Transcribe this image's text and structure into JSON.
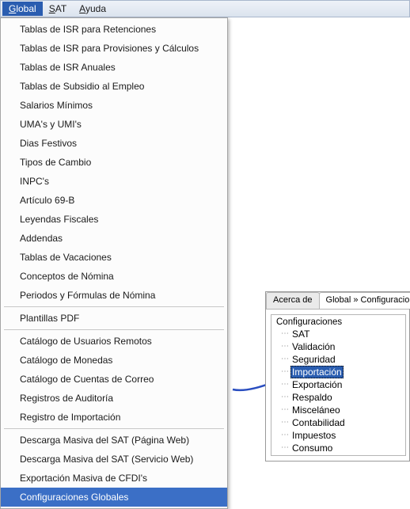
{
  "menubar": {
    "items": [
      {
        "label": "Global",
        "mnemonic_index": 0,
        "active": true
      },
      {
        "label": "SAT",
        "mnemonic_index": 0,
        "active": false
      },
      {
        "label": "Ayuda",
        "mnemonic_index": 0,
        "active": false
      }
    ]
  },
  "dropdown": {
    "entries": [
      {
        "type": "item",
        "label": "Tablas de ISR para Retenciones"
      },
      {
        "type": "item",
        "label": "Tablas de ISR para Provisiones y Cálculos"
      },
      {
        "type": "item",
        "label": "Tablas de ISR Anuales"
      },
      {
        "type": "item",
        "label": "Tablas de Subsidio al Empleo"
      },
      {
        "type": "item",
        "label": "Salarios Mínimos"
      },
      {
        "type": "item",
        "label": "UMA's y UMI's"
      },
      {
        "type": "item",
        "label": "Dias Festivos"
      },
      {
        "type": "item",
        "label": "Tipos de Cambio"
      },
      {
        "type": "item",
        "label": "INPC's"
      },
      {
        "type": "item",
        "label": "Artículo 69-B"
      },
      {
        "type": "item",
        "label": "Leyendas Fiscales"
      },
      {
        "type": "item",
        "label": "Addendas"
      },
      {
        "type": "item",
        "label": "Tablas de Vacaciones"
      },
      {
        "type": "item",
        "label": "Conceptos de Nómina"
      },
      {
        "type": "item",
        "label": "Periodos y Fórmulas de Nómina"
      },
      {
        "type": "sep"
      },
      {
        "type": "item",
        "label": "Plantillas PDF"
      },
      {
        "type": "sep"
      },
      {
        "type": "item",
        "label": "Catálogo de Usuarios Remotos"
      },
      {
        "type": "item",
        "label": "Catálogo de Monedas"
      },
      {
        "type": "item",
        "label": "Catálogo de Cuentas de Correo"
      },
      {
        "type": "item",
        "label": "Registros de Auditoría"
      },
      {
        "type": "item",
        "label": "Registro de Importación"
      },
      {
        "type": "sep"
      },
      {
        "type": "item",
        "label": "Descarga Masiva del SAT (Página Web)"
      },
      {
        "type": "item",
        "label": "Descarga Masiva del SAT (Servicio Web)"
      },
      {
        "type": "item",
        "label": "Exportación Masiva de CFDI's"
      },
      {
        "type": "item",
        "label": "Configuraciones Globales",
        "selected": true
      }
    ]
  },
  "tabs": {
    "items": [
      {
        "label": "Acerca de",
        "active": false
      },
      {
        "label": "Global » Configuraciones",
        "active": true
      }
    ]
  },
  "tree": {
    "root_label": "Configuraciones",
    "items": [
      {
        "label": "SAT"
      },
      {
        "label": "Validación"
      },
      {
        "label": "Seguridad"
      },
      {
        "label": "Importación",
        "selected": true
      },
      {
        "label": "Exportación"
      },
      {
        "label": "Respaldo"
      },
      {
        "label": "Misceláneo"
      },
      {
        "label": "Contabilidad"
      },
      {
        "label": "Impuestos"
      },
      {
        "label": "Consumo"
      }
    ]
  }
}
